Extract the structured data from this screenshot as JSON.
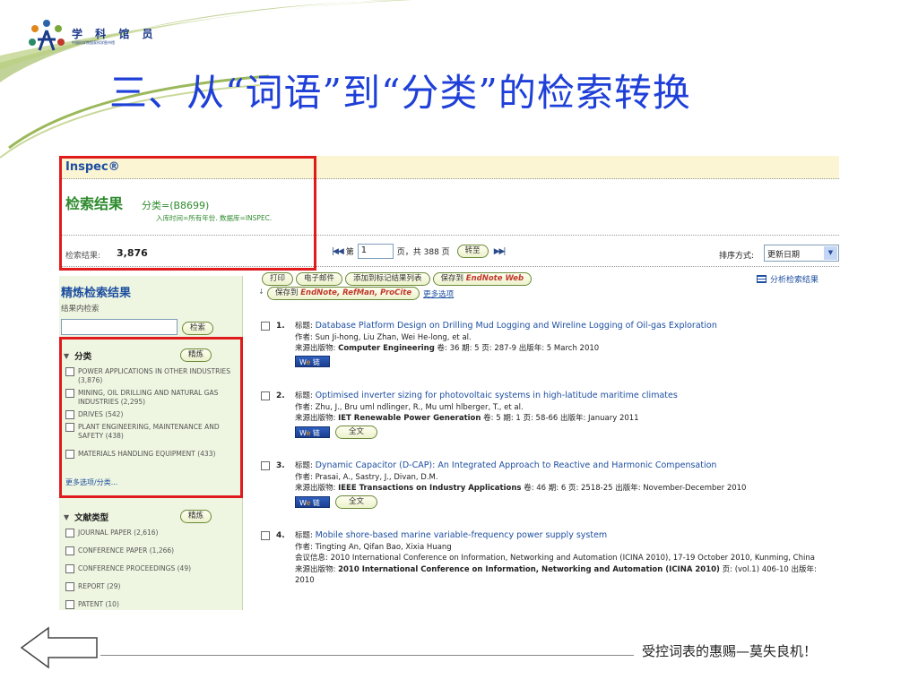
{
  "slide": {
    "logo": {
      "name": "学 科 馆 员",
      "subtitle": "中国科学院国家科学图书馆"
    },
    "title": "三、从“词语”到“分类”的检索转换",
    "tagline": "受控词表的惠赐—莫失良机！",
    "colors": {
      "title": "#1e3fd8",
      "highlight_box": "#e01b1b"
    }
  },
  "screen": {
    "brand": "Inspec®",
    "results_header": {
      "title": "检索结果",
      "query": "分类=(B8699)",
      "sub": "入库时间=所有年份. 数据库=INSPEC."
    },
    "count": {
      "label": "检索结果:",
      "value": "3,876"
    },
    "pager": {
      "first_prev": "|◀ ◀",
      "page_label": "第",
      "current_page": "1",
      "total": "页，共 388 页",
      "go": "转至",
      "next_last": "▶ ▶|"
    },
    "sort": {
      "label": "排序方式:",
      "selected": "更新日期"
    },
    "sidebar": {
      "title": "精炼检索结果",
      "within_label": "结果内检索",
      "search_button": "检索",
      "category": {
        "label": "分类",
        "refine_button": "精炼",
        "items": [
          {
            "label": "POWER APPLICATIONS IN OTHER INDUSTRIES (3,876)"
          },
          {
            "label": "MINING, OIL DRILLING AND NATURAL GAS INDUSTRIES (2,295)"
          },
          {
            "label": "DRIVES (542)"
          },
          {
            "label": "PLANT ENGINEERING, MAINTENANCE AND SAFETY (438)"
          },
          {
            "label": "MATERIALS HANDLING EQUIPMENT (433)"
          }
        ],
        "more": "更多选项/分类..."
      },
      "doctype": {
        "label": "文献类型",
        "refine_button": "精炼",
        "items": [
          {
            "label": "JOURNAL PAPER (2,616)"
          },
          {
            "label": "CONFERENCE PAPER (1,266)"
          },
          {
            "label": "CONFERENCE PROCEEDINGS (49)"
          },
          {
            "label": "REPORT (29)"
          },
          {
            "label": "PATENT (10)"
          }
        ]
      }
    },
    "actions": {
      "print": "打印",
      "email": "电子邮件",
      "add_marked": "添加到标记结果列表",
      "save_to": "保存到",
      "endnote_web": "EndNote Web",
      "save_to_prefix": "保存到",
      "endnote_refman": "EndNote, RefMan, ProCite",
      "more_options": "更多选项",
      "analyze": "分析检索结果"
    },
    "result_labels": {
      "title": "标题:",
      "authors": "作者:",
      "source": "来源出版物:",
      "conference": "会议信息:",
      "link": "链",
      "fulltext": "全文"
    },
    "results": [
      {
        "num": "1.",
        "title": "Database Platform Design on Drilling Mud Logging and Wireline Logging of Oil-gas Exploration",
        "authors": "Sun Ji-hong, Liu Zhan, Wei He-long, et al.",
        "source": "Computer Engineering",
        "details": "卷: 36 期: 5 页: 287-9 出版年: 5 March 2010"
      },
      {
        "num": "2.",
        "title": "Optimised inverter sizing for photovoltaic systems in high-latitude maritime climates",
        "authors": "Zhu, J., Bru uml ndlinger, R., Mu uml hlberger, T., et al.",
        "source": "IET Renewable Power Generation",
        "details": "卷: 5 期: 1 页: 58-66 出版年: January 2011"
      },
      {
        "num": "3.",
        "title": "Dynamic Capacitor (D-CAP): An Integrated Approach to Reactive and Harmonic Compensation",
        "authors": "Prasai, A., Sastry, J., Divan, D.M.",
        "source": "IEEE Transactions on Industry Applications",
        "details": "卷: 46 期: 6 页: 2518-25 出版年: November-December 2010"
      },
      {
        "num": "4.",
        "title": "Mobile shore-based marine variable-frequency power supply system",
        "authors": "Tingting An, Qifan Bao, Xixia Huang",
        "conference": "2010 International Conference on Information, Networking and Automation (ICINA 2010), 17-19 October 2010, Kunming, China",
        "source": "2010 International Conference on Information, Networking and Automation (ICINA 2010)",
        "details": "页: (vol.1) 406-10 出版年: 2010"
      }
    ]
  }
}
